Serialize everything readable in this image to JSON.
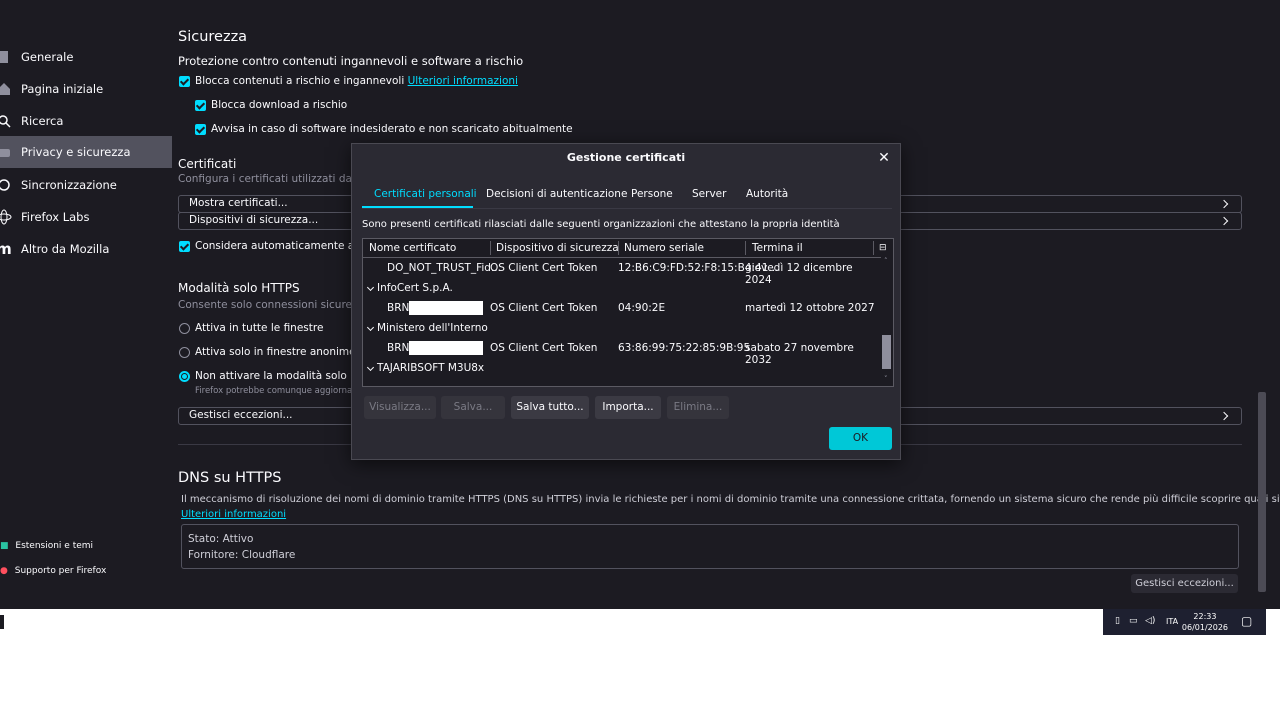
{
  "sidebar": {
    "items": [
      {
        "label": "Generale",
        "icon": "gear-icon"
      },
      {
        "label": "Pagina iniziale",
        "icon": "home-icon"
      },
      {
        "label": "Ricerca",
        "icon": "search-icon"
      },
      {
        "label": "Privacy e sicurezza",
        "icon": "lock-icon"
      },
      {
        "label": "Sincronizzazione",
        "icon": "sync-icon"
      },
      {
        "label": "Firefox Labs",
        "icon": "flask-icon"
      },
      {
        "label": "Altro da Mozilla",
        "icon": "mozilla-icon"
      }
    ],
    "footer": [
      {
        "label": "Estensioni e temi",
        "icon": "puzzle-icon"
      },
      {
        "label": "Supporto per Firefox",
        "icon": "help-icon"
      }
    ]
  },
  "security": {
    "title": "Sicurezza",
    "protection_title": "Protezione contro contenuti ingannevoli e software a rischio",
    "block_risky": "Blocca contenuti a rischio e ingannevoli",
    "more_info": "Ulteriori informazioni",
    "block_downloads": "Blocca download a rischio",
    "warn_unwanted": "Avvisa in caso di software indesiderato e non scaricato abitualmente"
  },
  "certificates": {
    "title": "Certificati",
    "description": "Configura i certificati utilizzati da Firefox",
    "show_certs": "Mostra certificati...",
    "security_devices": "Dispositivi di sicurezza...",
    "auto_trust": "Considera automaticamente attendi"
  },
  "https_only": {
    "title": "Modalità solo HTTPS",
    "description": "Consente solo connessioni sicure ai siti",
    "opt_all": "Attiva in tutte le finestre",
    "opt_private": "Attiva solo in finestre anonime",
    "opt_off": "Non attivare la modalità solo HTTPS",
    "opt_off_note": "Firefox potrebbe comunque aggiornare a",
    "manage_exceptions": "Gestisci eccezioni..."
  },
  "dns": {
    "title": "DNS su HTTPS",
    "description": "Il meccanismo di risoluzione dei nomi di dominio tramite HTTPS (DNS su HTTPS) invia le richieste per i nomi di dominio tramite una connessione crittata, fornendo un sistema sicuro che rende più difficile scoprire quali siti stai per visitare.",
    "more_info": "Ulteriori informazioni",
    "status": "Stato: Attivo",
    "provider": "Fornitore: Cloudflare",
    "manage_exceptions": "Gestisci eccezioni..."
  },
  "dialog": {
    "title": "Gestione certificati",
    "tabs": [
      "Certificati personali",
      "Decisioni di autenticazione",
      "Persone",
      "Server",
      "Autorità"
    ],
    "intro": "Sono presenti certificati rilasciati dalle seguenti organizzazioni che attestano la propria identità",
    "columns": [
      "Nome certificato",
      "Dispositivo di sicurezza",
      "Numero seriale",
      "Termina il"
    ],
    "rows": [
      {
        "type": "cert",
        "name": "DO_NOT_TRUST_Fid...",
        "device": "OS Client Cert Token",
        "serial": "12:B6:C9:FD:52:F8:15:B4:41...",
        "expires": "giovedì 12 dicembre 2024"
      },
      {
        "type": "group",
        "name": "InfoCert S.p.A."
      },
      {
        "type": "cert",
        "name": "BRN",
        "device": "OS Client Cert Token",
        "serial": "04:90:2E",
        "expires": "martedì 12 ottobre 2027"
      },
      {
        "type": "group",
        "name": "Ministero dell'Interno"
      },
      {
        "type": "cert",
        "name": "BRN",
        "device": "OS Client Cert Token",
        "serial": "63:86:99:75:22:85:9B:95",
        "expires": "sabato 27 novembre 2032"
      },
      {
        "type": "group",
        "name": "TAJARIBSOFT M3U8x"
      }
    ],
    "buttons": {
      "view": "Visualizza...",
      "save": "Salva...",
      "save_all": "Salva tutto...",
      "import": "Importa...",
      "delete": "Elimina..."
    },
    "ok": "OK"
  },
  "taskbar": {
    "language": "ITA",
    "time": "22:33",
    "date": "06/01/2026"
  },
  "colors": {
    "accent": "#00ddff",
    "background": "#1c1b22",
    "dialog": "#2b2a33"
  }
}
